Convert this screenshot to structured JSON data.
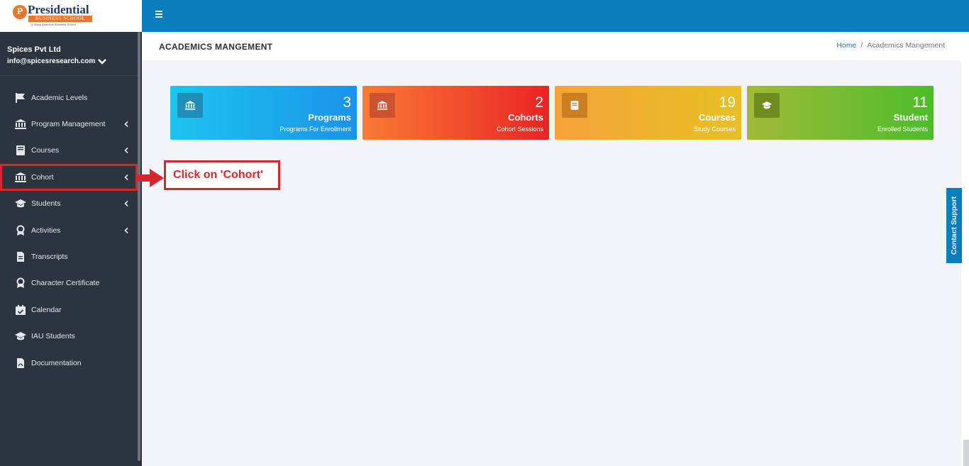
{
  "brand": {
    "logo_letter": "P",
    "name": "Presidential",
    "subtitle": "BUSINESS SCHOOL",
    "tagline": "A Swiss American Business School"
  },
  "user": {
    "company": "Spices Pvt Ltd",
    "email": "info@spicesresearch.com"
  },
  "sidebar": {
    "items": [
      {
        "label": "Academic Levels",
        "icon": "flag-icon",
        "has_caret": false
      },
      {
        "label": "Program Management",
        "icon": "institution-icon",
        "has_caret": true
      },
      {
        "label": "Courses",
        "icon": "book-icon",
        "has_caret": true
      },
      {
        "label": "Cohort",
        "icon": "institution-icon",
        "has_caret": true
      },
      {
        "label": "Students",
        "icon": "graduation-cap-icon",
        "has_caret": true
      },
      {
        "label": "Activities",
        "icon": "award-icon",
        "has_caret": true
      },
      {
        "label": "Transcripts",
        "icon": "file-text-icon",
        "has_caret": false
      },
      {
        "label": "Character Certificate",
        "icon": "award-icon",
        "has_caret": false
      },
      {
        "label": "Calendar",
        "icon": "calendar-check-icon",
        "has_caret": false
      },
      {
        "label": "IAU Students",
        "icon": "graduation-cap-icon",
        "has_caret": false
      },
      {
        "label": "Documentation",
        "icon": "file-pdf-icon",
        "has_caret": false
      }
    ]
  },
  "header": {
    "page_title": "ACADEMICS MANGEMENT",
    "breadcrumb": {
      "home": "Home",
      "separator": "/",
      "current": "Academics Mangement"
    }
  },
  "cards": [
    {
      "number": "3",
      "title": "Programs",
      "subtitle": "Programs For Enrollment",
      "icon": "institution-icon"
    },
    {
      "number": "2",
      "title": "Cohorts",
      "subtitle": "Cohort Sessions",
      "icon": "institution-icon"
    },
    {
      "number": "19",
      "title": "Courses",
      "subtitle": "Study Courses",
      "icon": "book-icon"
    },
    {
      "number": "11",
      "title": "Student",
      "subtitle": "Enrolled Students",
      "icon": "graduation-cap-icon"
    }
  ],
  "annotation": {
    "text": "Click on 'Cohort'",
    "color": "#d7262d"
  },
  "contact_support": "Contact Support",
  "colors": {
    "topbar": "#0a7dbd",
    "sidebar": "#2c3440",
    "highlight": "#d7262d"
  }
}
